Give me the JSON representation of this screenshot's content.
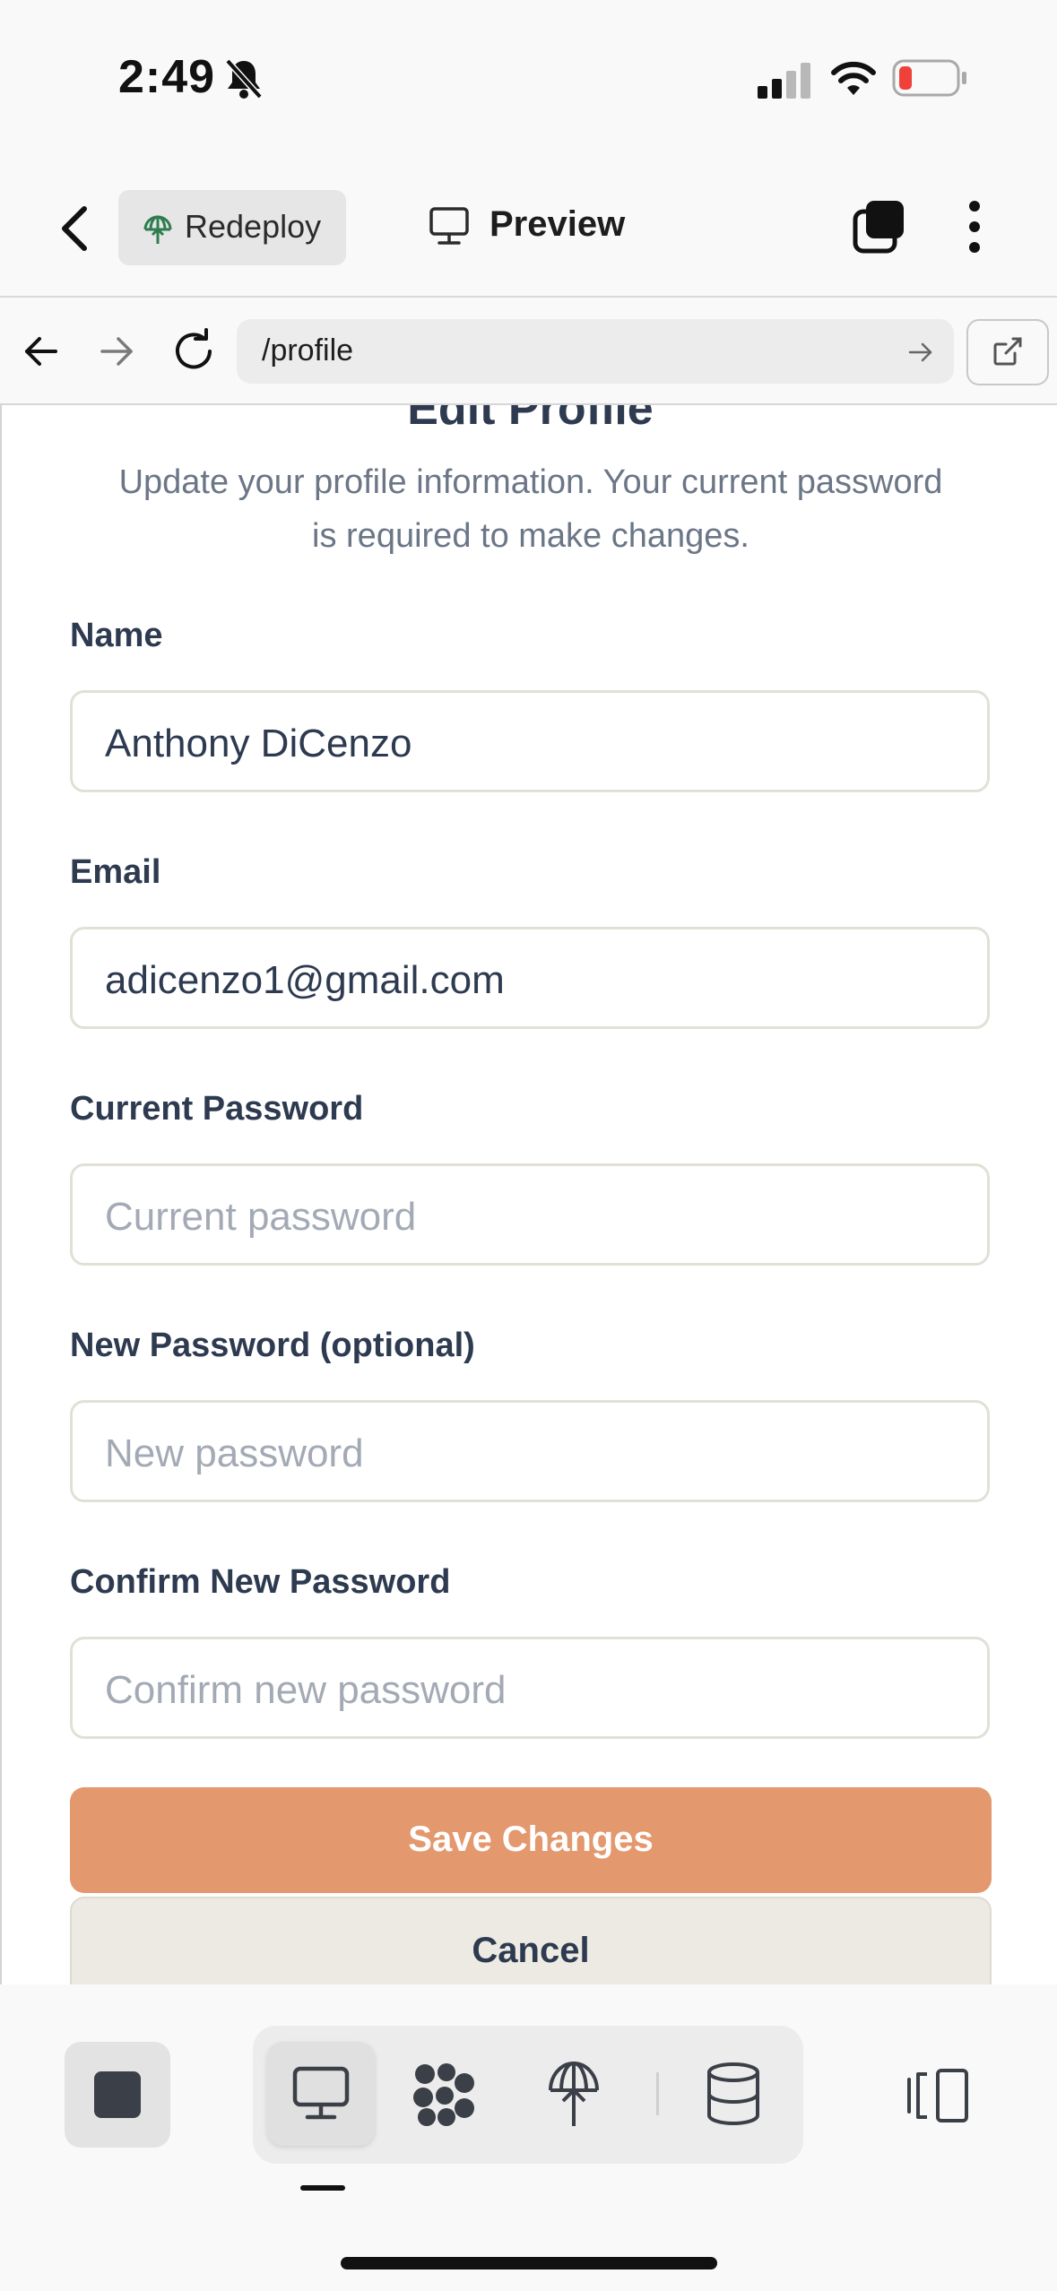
{
  "status_bar": {
    "time": "2:49",
    "icons": [
      "bell-slash-icon",
      "cellular-signal-icon",
      "wifi-icon",
      "battery-low-icon"
    ],
    "battery_color": "#f0403a"
  },
  "header": {
    "redeploy_label": "Redeploy",
    "preview_label": "Preview",
    "icons": [
      "back-chevron-icon",
      "redeploy-icon",
      "monitor-icon",
      "tabs-icon",
      "more-vertical-icon"
    ]
  },
  "url_bar": {
    "url": "/profile",
    "icons": [
      "arrow-left-icon",
      "arrow-right-icon",
      "reload-icon",
      "go-arrow-icon",
      "open-external-icon"
    ]
  },
  "form": {
    "title": "Edit Profile",
    "subtitle": "Update your profile information. Your current password is required to make changes.",
    "fields": {
      "name": {
        "label": "Name",
        "value": "Anthony DiCenzo"
      },
      "email": {
        "label": "Email",
        "value": "adicenzo1@gmail.com"
      },
      "current_password": {
        "label": "Current Password",
        "placeholder": "Current password"
      },
      "new_password": {
        "label": "New Password (optional)",
        "placeholder": "New password"
      },
      "confirm_password": {
        "label": "Confirm New Password",
        "placeholder": "Confirm new password"
      }
    },
    "save_label": "Save Changes",
    "cancel_label": "Cancel"
  },
  "toolbar": {
    "icons": [
      "stop-icon",
      "desktop-view-icon",
      "network-icon",
      "deploy-icon",
      "database-icon",
      "panel-toggle-icon"
    ],
    "active_view": "desktop",
    "accent_color": "#e3986e"
  }
}
